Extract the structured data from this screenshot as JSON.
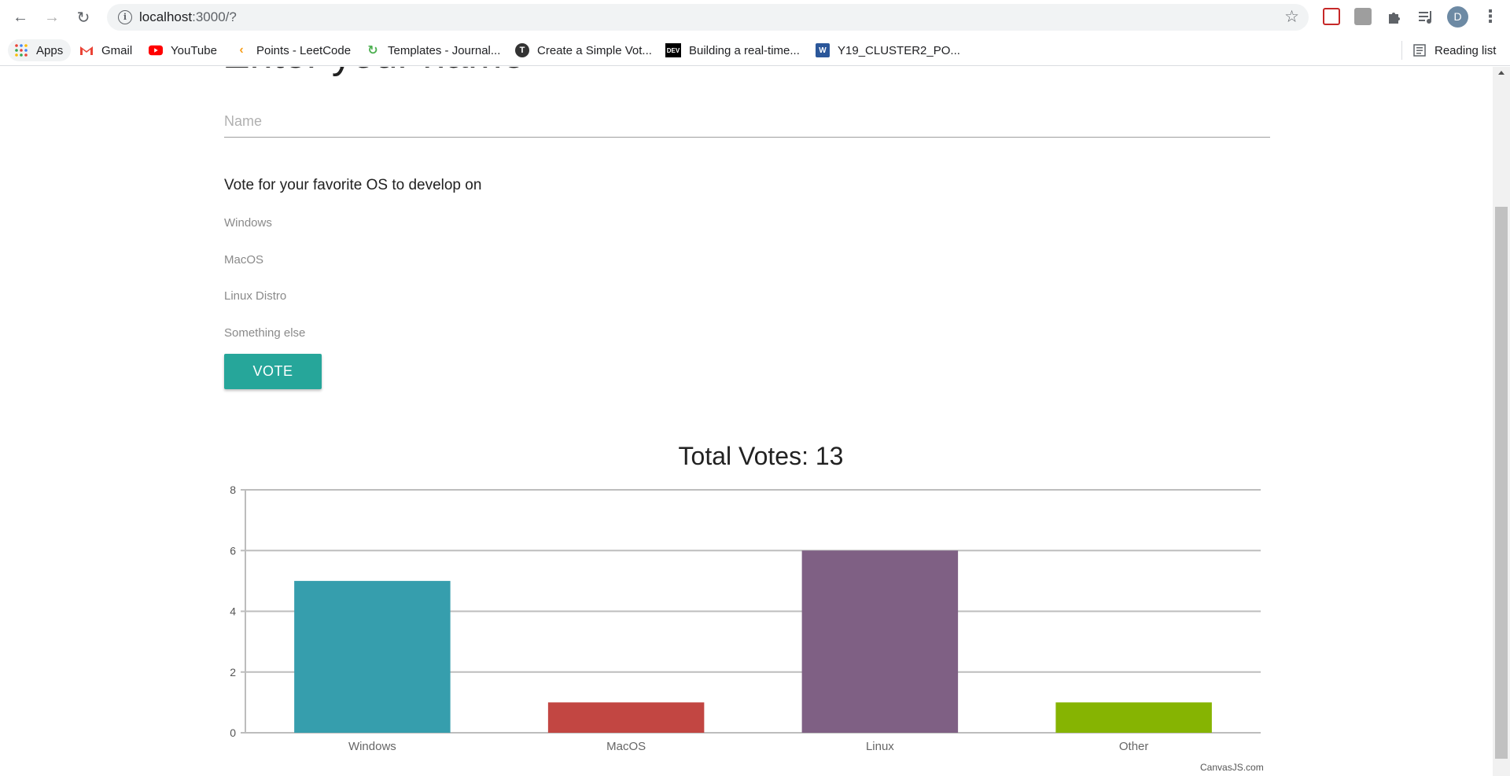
{
  "browser": {
    "url_host": "localhost",
    "url_rest": ":3000/?",
    "profile_initial": "D",
    "bookmarks": [
      {
        "label": "Apps"
      },
      {
        "label": "Gmail"
      },
      {
        "label": "YouTube"
      },
      {
        "label": "Points - LeetCode"
      },
      {
        "label": "Templates - Journal..."
      },
      {
        "label": "Create a Simple Vot..."
      },
      {
        "label": "Building a real-time..."
      },
      {
        "label": "Y19_CLUSTER2_PO..."
      }
    ],
    "reading_list": "Reading list"
  },
  "page": {
    "heading": "Enter your name",
    "name_placeholder": "Name",
    "vote_prompt": "Vote for your favorite OS to develop on",
    "options": [
      "Windows",
      "MacOS",
      "Linux Distro",
      "Something else"
    ],
    "vote_button": "VOTE",
    "credit": "CanvasJS.com",
    "accent": "#26a69a"
  },
  "chart_data": {
    "type": "bar",
    "title": "Total Votes: 13",
    "categories": [
      "Windows",
      "MacOS",
      "Linux",
      "Other"
    ],
    "values": [
      5,
      1,
      6,
      1
    ],
    "colors": [
      "#369ead",
      "#c24642",
      "#7f6084",
      "#86b402"
    ],
    "ylim": [
      0,
      8
    ],
    "yticks": [
      0,
      2,
      4,
      6,
      8
    ],
    "grid": true,
    "xlabel": "",
    "ylabel": ""
  }
}
